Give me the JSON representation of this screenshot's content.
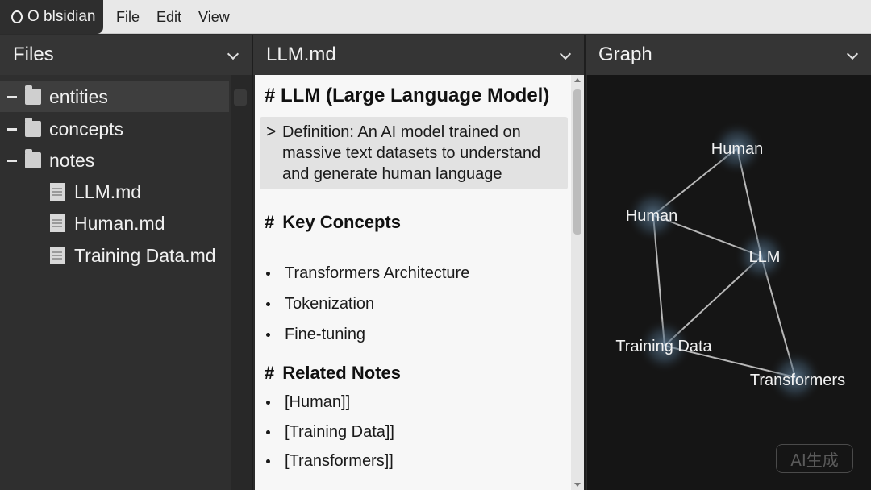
{
  "app": {
    "name": "Obsidian",
    "title_display": "O blsidian"
  },
  "menu": {
    "items": [
      "File",
      "Edit",
      "View"
    ]
  },
  "panes": {
    "files": {
      "title": "Files",
      "tree": [
        {
          "type": "folder",
          "label": "entities",
          "selected": true
        },
        {
          "type": "folder",
          "label": "concepts"
        },
        {
          "type": "folder",
          "label": "notes"
        },
        {
          "type": "file",
          "label": "LLM.md"
        },
        {
          "type": "file",
          "label": "Human.md"
        },
        {
          "type": "file",
          "label": "Training Data.md"
        }
      ]
    },
    "editor": {
      "title": "LLM.md",
      "heading": "# LLM (Large Language Model)",
      "blockquote_mark": ">",
      "blockquote": "Definition: An AI model trained on massive text datasets to understand and generate human language",
      "key_concepts_hash": "#",
      "key_concepts_heading": "Key Concepts",
      "key_concepts": [
        "Transformers Architecture",
        "Tokenization",
        "Fine-tuning"
      ],
      "related_hash": "#",
      "related_heading": "Related Notes",
      "related": [
        "[Human]]",
        "[Training Data]]",
        "[Transformers]]"
      ]
    },
    "graph": {
      "title": "Graph",
      "nodes": [
        "Human",
        "Human",
        "LLM",
        "Training Data",
        "Transformers"
      ],
      "watermark": "AI生成"
    }
  },
  "icons": {
    "collapse": "chevron-down-icon",
    "folder": "folder-icon",
    "file": "file-icon"
  },
  "colors": {
    "sidebar_bg": "#2f2f2f",
    "editor_bg": "#f7f7f7",
    "graph_bg": "#151515",
    "node_glow": "#6a8aa6"
  }
}
